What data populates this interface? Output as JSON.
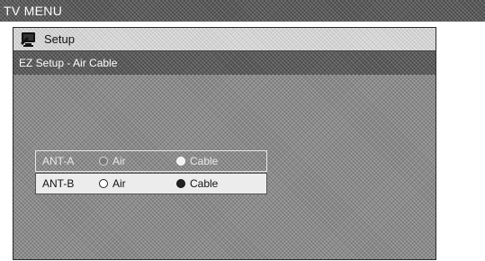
{
  "window": {
    "title": "TV MENU"
  },
  "setup": {
    "title": "Setup",
    "icon": "tv-setup-icon"
  },
  "subtitle": "EZ Setup - Air Cable",
  "antennas": [
    {
      "label": "ANT-A",
      "options": [
        "Air",
        "Cable"
      ],
      "selected": "Cable"
    },
    {
      "label": "ANT-B",
      "options": [
        "Air",
        "Cable"
      ],
      "selected": "Cable"
    }
  ]
}
